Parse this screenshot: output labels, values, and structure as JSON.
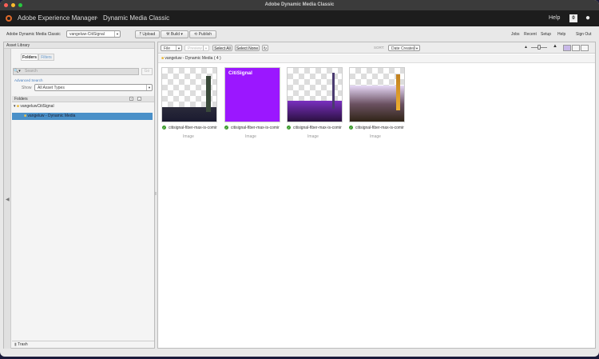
{
  "window": {
    "title": "Adobe Dynamic Media Classic"
  },
  "header": {
    "app": "Adobe Experience Manager",
    "separator": ">",
    "section": "Dynamic Media Classic",
    "help": "Help",
    "notification_count": "0"
  },
  "topbar": {
    "label": "Adobe Dynamic Media Classic",
    "company": "vangeluw-CitiSignal",
    "upload": "Upload",
    "build": "Build",
    "publish": "Publish",
    "links": [
      "Jobs",
      "Recent",
      "Setup",
      "Help",
      "Sign Out"
    ]
  },
  "asset_library": {
    "title": "Asset Library",
    "tabs": [
      "Folders",
      "Filters"
    ],
    "search_placeholder": "Search",
    "go": "Go",
    "advanced_search": "Advanced Search",
    "show_label": "Show",
    "show_value": "All Asset Types",
    "folders_title": "Folders",
    "tree": [
      {
        "label": "vangeluwCitiSignal"
      },
      {
        "label": "vangeluw - Dynamic Media",
        "selected": true
      }
    ],
    "trash": "Trash"
  },
  "browser": {
    "file": "File",
    "preview": "Preview",
    "select_all": "Select All",
    "select_none": "Select None",
    "sort_label": "SORT:",
    "sort_value": "Date Created",
    "breadcrumb": "vangeluw - Dynamic Media ( 4 )",
    "assets": [
      {
        "name": "citisignal-fiber-max-is-comir",
        "type": "Image"
      },
      {
        "name": "citisignal-fiber-max-is-comir",
        "type": "Image",
        "brand_text": "CitiSignal"
      },
      {
        "name": "citisignal-fiber-max-is-comir",
        "type": "Image"
      },
      {
        "name": "citisignal-fiber-max-is-comir",
        "type": "Image"
      }
    ]
  },
  "colors": {
    "accent": "#4a90c8",
    "brand_purple": "#9b17ff",
    "selected_row": "#4a90c8"
  }
}
